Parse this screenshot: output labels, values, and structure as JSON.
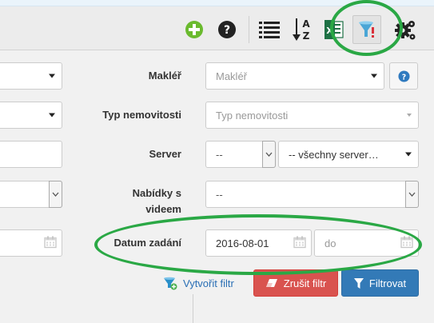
{
  "toolbar": {
    "icons": [
      "add-icon",
      "help-icon",
      "list-icon",
      "sort-az-icon",
      "excel-icon",
      "filter-icon",
      "settings-icon"
    ],
    "sort_letter_top": "A",
    "sort_letter_bottom": "Z",
    "excel_letter": "X"
  },
  "form": {
    "makler": {
      "label": "Makléř",
      "placeholder": "Makléř"
    },
    "typ": {
      "label": "Typ nemovitosti",
      "placeholder": "Typ nemovitosti"
    },
    "server": {
      "label": "Server",
      "value_1": "--",
      "value_2": "-- všechny server…"
    },
    "nabidky": {
      "label_line1": "Nabídky s",
      "label_line2": "videem",
      "value": "--"
    },
    "datum": {
      "label": "Datum zadání",
      "from_value": "2016-08-01",
      "to_placeholder": "do"
    }
  },
  "actions": {
    "create_filter": "Vytvořit filtr",
    "cancel_filter": "Zrušit filtr",
    "apply_filter": "Filtrovat"
  },
  "colors": {
    "highlight": "#2aa845",
    "danger": "#d9534f",
    "primary": "#337ab7",
    "add_green": "#5cb85c"
  }
}
